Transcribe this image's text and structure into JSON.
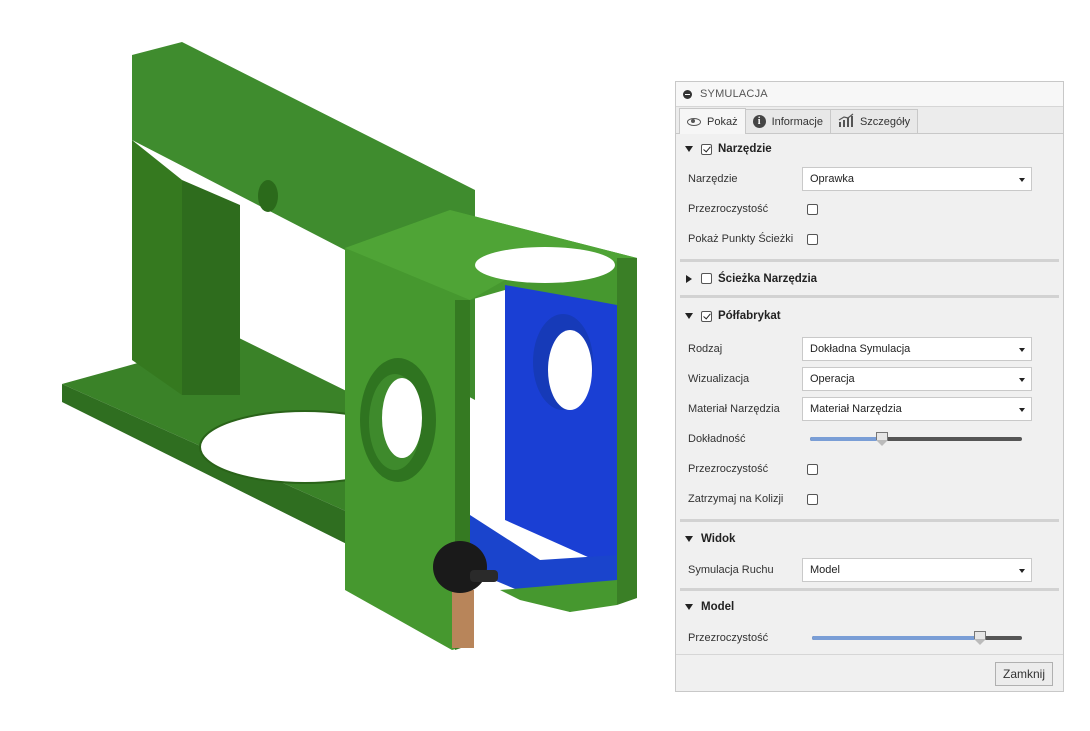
{
  "panel": {
    "title": "SYMULACJA",
    "tabs": [
      {
        "label": "Pokaż",
        "icon": "eye-icon",
        "active": true
      },
      {
        "label": "Informacje",
        "icon": "info-icon"
      },
      {
        "label": "Szczegóły",
        "icon": "chart-icon"
      }
    ],
    "sections": {
      "tool": {
        "title": "Narzędzie",
        "checked": true,
        "tool_label": "Narzędzie",
        "tool_value": "Oprawka",
        "transparency_label": "Przezroczystość",
        "show_points_label": "Pokaż Punkty Ścieżki"
      },
      "toolpath": {
        "title": "Ścieżka Narzędzia",
        "checked": false
      },
      "stock": {
        "title": "Półfabrykat",
        "checked": true,
        "type_label": "Rodzaj",
        "type_value": "Dokładna Symulacja",
        "visual_label": "Wizualizacja",
        "visual_value": "Operacja",
        "material_label": "Materiał Narzędzia",
        "material_value": "Materiał Narzędzia",
        "accuracy_label": "Dokładność",
        "accuracy_fraction": 0.34,
        "transparency_label": "Przezroczystość",
        "stop_collision_label": "Zatrzymaj na Kolizji"
      },
      "view": {
        "title": "Widok",
        "motion_label": "Symulacja Ruchu",
        "motion_value": "Model"
      },
      "model": {
        "title": "Model",
        "transparency_label": "Przezroczystość",
        "transparency_fraction": 0.8
      }
    },
    "close_label": "Zamknij"
  },
  "colors": {
    "part_green": "#3f8c2e",
    "stock_blue": "#1a3fd4",
    "slider_fill": "#7a9ed6"
  }
}
